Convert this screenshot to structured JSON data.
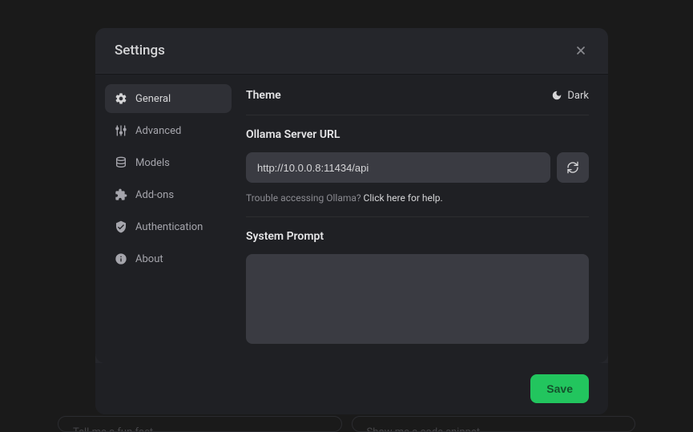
{
  "modal": {
    "title": "Settings",
    "sidebar": {
      "items": [
        {
          "label": "General"
        },
        {
          "label": "Advanced"
        },
        {
          "label": "Models"
        },
        {
          "label": "Add-ons"
        },
        {
          "label": "Authentication"
        },
        {
          "label": "About"
        }
      ]
    },
    "theme": {
      "label": "Theme",
      "value": "Dark"
    },
    "server": {
      "label": "Ollama Server URL",
      "value": "http://10.0.0.8:11434/api",
      "help_prefix": "Trouble accessing Ollama? ",
      "help_link": "Click here for help."
    },
    "prompt": {
      "label": "System Prompt",
      "value": ""
    },
    "save_label": "Save"
  },
  "background": {
    "chips": [
      {
        "text": "Tell me a fun fact"
      },
      {
        "text": "Show me a code snippet"
      }
    ]
  }
}
